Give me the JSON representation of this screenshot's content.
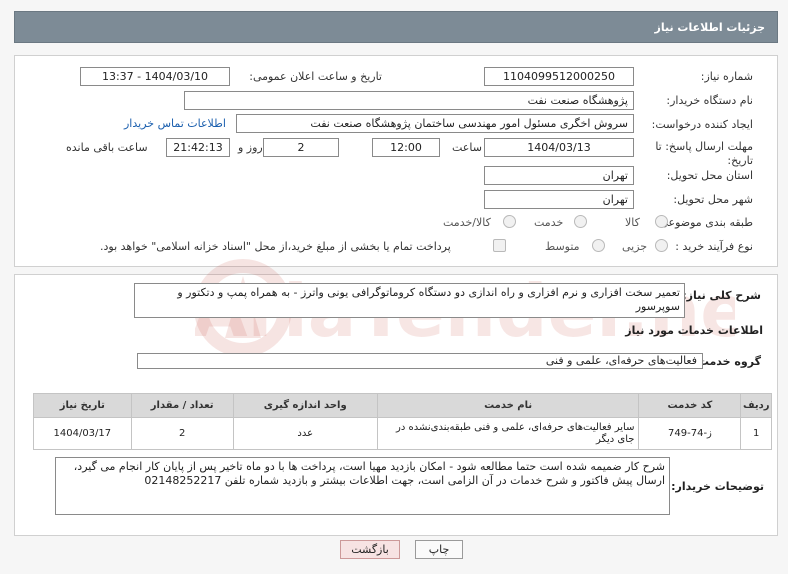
{
  "header": {
    "title": "جزئیات اطلاعات نیاز"
  },
  "fields": {
    "need_number_label": "شماره نیاز:",
    "need_number": "1104099512000250",
    "announce_datetime_label": "تاریخ و ساعت اعلان عمومی:",
    "announce_datetime": "1404/03/10 - 13:37",
    "buyer_org_label": "نام دستگاه خریدار:",
    "buyer_org": "پژوهشگاه صنعت نفت",
    "requester_label": "ایجاد کننده درخواست:",
    "requester": "سروش اخگری مسئول امور مهندسی ساختمان پژوهشگاه صنعت نفت",
    "buyer_contact_link": "اطلاعات تماس خریدار",
    "deadline_label": "مهلت ارسال پاسخ: تا تاریخ:",
    "deadline_date": "1404/03/13",
    "time_label": "ساعت",
    "deadline_time": "12:00",
    "days_value": "2",
    "days_label": "روز و",
    "remaining_time": "21:42:13",
    "remaining_label": "ساعت باقی مانده",
    "province_label": "استان محل تحویل:",
    "province": "تهران",
    "city_label": "شهر محل تحویل:",
    "city": "تهران",
    "category_label": "طبقه بندی موضوعی:",
    "category_options": [
      "کالا",
      "خدمت",
      "کالا/خدمت"
    ],
    "purchase_type_label": "نوع فرآیند خرید :",
    "purchase_options": [
      "جزیی",
      "متوسط"
    ],
    "payment_note": "پرداخت تمام یا بخشی از مبلغ خرید،از محل \"اسناد خزانه اسلامی\" خواهد بود."
  },
  "need_summary": {
    "label": "شرح کلی نیاز:",
    "text": "تعمیر سخت افزاری و نرم افزاری و راه اندازی  دو دستگاه کروماتوگرافی یونی واترز - به همراه پمپ و دتکتور و سوپرسور"
  },
  "services": {
    "section_title": "اطلاعات خدمات مورد نیاز",
    "group_label": "گروه خدمت:",
    "group_value": "فعالیت‌های حرفه‌ای، علمی و فنی",
    "columns": [
      "ردیف",
      "کد خدمت",
      "نام خدمت",
      "واحد اندازه گیری",
      "تعداد / مقدار",
      "تاریخ نیاز"
    ],
    "rows": [
      [
        "1",
        "ز-74-749",
        "سایر فعالیت‌های حرفه‌ای، علمی و فنی طبقه‌بندی‌نشده در جای دیگر",
        "عدد",
        "2",
        "1404/03/17"
      ]
    ]
  },
  "buyer_notes": {
    "label": "توضیحات خریدار:",
    "text": "شرح کار ضمیمه شده است حتما مطالعه شود - امکان بازدید مهیا است، پرداخت ها با دو ماه تاخیر پس از پایان کار انجام می گیرد، ارسال پیش فاکتور و شرح خدمات در آن الزامی است، جهت اطلاعات بیشتر و بازدید شماره تلفن 02148252217"
  },
  "buttons": {
    "print": "چاپ",
    "back": "بازگشت"
  },
  "watermark": {
    "text": "AriaTender.neT"
  },
  "colors": {
    "header_bg": "#7d8b96",
    "link": "#1b5fae",
    "back_btn": "#f7e3e3"
  }
}
